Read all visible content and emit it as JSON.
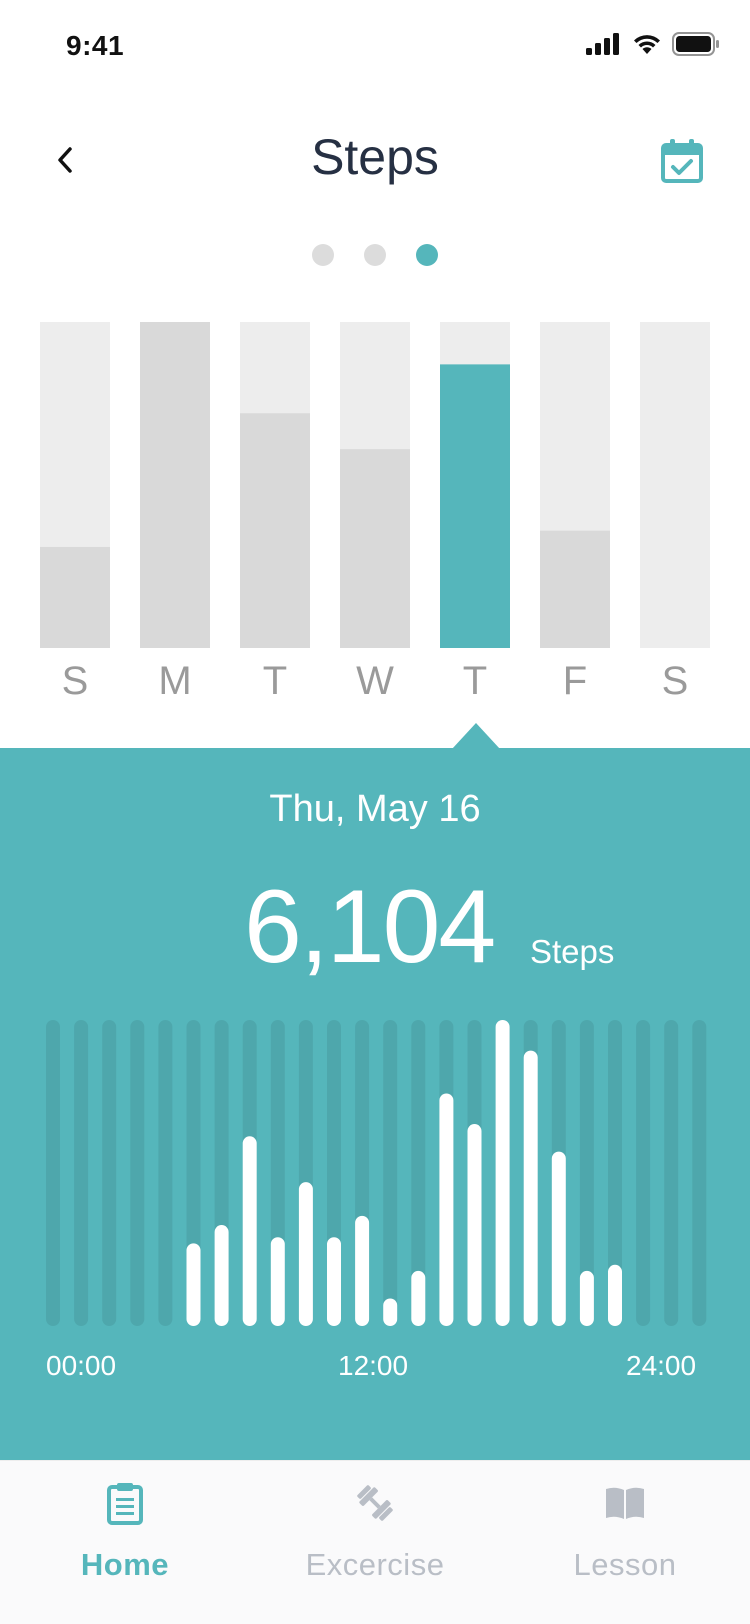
{
  "status_bar": {
    "time": "9:41"
  },
  "header": {
    "title": "Steps"
  },
  "pager": {
    "count": 3,
    "active_index": 2
  },
  "colors": {
    "accent": "#55b6bb",
    "bar_track": "#ededed",
    "bar_fill": "#d9d9d9",
    "title": "#263043",
    "inactive_tab": "#b9bec6"
  },
  "chart_data": [
    {
      "type": "bar",
      "categories": [
        "S",
        "M",
        "T",
        "W",
        "T",
        "F",
        "S"
      ],
      "values": [
        0.31,
        1.0,
        0.72,
        0.61,
        0.87,
        0.36,
        0.0
      ],
      "selected_index": 4,
      "ylim": [
        0,
        1
      ]
    },
    {
      "type": "bar",
      "x_tick_labels": [
        "00:00",
        "12:00",
        "24:00"
      ],
      "values": [
        0,
        0,
        0,
        0,
        0,
        0.27,
        0.33,
        0.62,
        0.29,
        0.47,
        0.29,
        0.36,
        0.09,
        0.18,
        0.76,
        0.66,
        1.0,
        0.9,
        0.57,
        0.18,
        0.2,
        0,
        0,
        0
      ],
      "ylim": [
        0,
        1
      ]
    }
  ],
  "detail": {
    "date": "Thu, May 16",
    "count": "6,104",
    "unit": "Steps"
  },
  "tab_bar": {
    "tabs": [
      {
        "label": "Home",
        "icon": "clipboard-icon",
        "active": true
      },
      {
        "label": "Excercise",
        "icon": "dumbbell-icon",
        "active": false
      },
      {
        "label": "Lesson",
        "icon": "book-icon",
        "active": false
      }
    ]
  }
}
